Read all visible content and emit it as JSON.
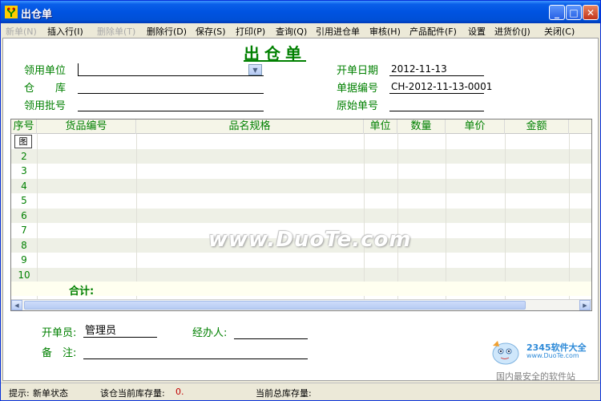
{
  "window": {
    "title": "出仓单"
  },
  "menu": [
    {
      "label": "新单(N)",
      "enabled": false
    },
    {
      "label": "插入行(I)",
      "enabled": true
    },
    {
      "label": "删除单(T)",
      "enabled": false
    },
    {
      "label": "删除行(D)",
      "enabled": true
    },
    {
      "label": "保存(S)",
      "enabled": true
    },
    {
      "label": "打印(P)",
      "enabled": true
    },
    {
      "label": "查询(Q)",
      "enabled": true
    },
    {
      "label": "引用进仓单",
      "enabled": true
    },
    {
      "label": "审核(H)",
      "enabled": true
    },
    {
      "label": "产品配件(F)",
      "enabled": true
    },
    {
      "label": "设置",
      "enabled": true
    },
    {
      "label": "进货价(J)",
      "enabled": true
    },
    {
      "label": "关闭(C)",
      "enabled": true
    }
  ],
  "form": {
    "title": "出仓单",
    "dept_label": "领用单位",
    "dept_value": "",
    "warehouse_label": "仓　　库",
    "warehouse_value": "",
    "batch_label": "领用批号",
    "batch_value": "",
    "date_label": "开单日期",
    "date_value": "2012-11-13",
    "docno_label": "单据编号",
    "docno_value": "CH-2012-11-13-0001",
    "origno_label": "原始单号",
    "origno_value": ""
  },
  "grid": {
    "columns": [
      "序号",
      "货品编号",
      "品名规格",
      "单位",
      "数量",
      "单价",
      "金额"
    ],
    "rows": [
      {
        "num": "图"
      },
      {
        "num": "2"
      },
      {
        "num": "3"
      },
      {
        "num": "4"
      },
      {
        "num": "5"
      },
      {
        "num": "6"
      },
      {
        "num": "7"
      },
      {
        "num": "8"
      },
      {
        "num": "9"
      },
      {
        "num": "10"
      }
    ],
    "total_label": "合计:"
  },
  "footer": {
    "creator_label": "开单员:",
    "creator_value": "管理员",
    "handler_label": "经办人:",
    "handler_value": "",
    "notes_label": "备　注:",
    "notes_value": ""
  },
  "status": {
    "hint_label": "提示:",
    "hint_value": "新单状态",
    "stock_label": "该仓当前库存量:",
    "stock_value": "0.",
    "total_stock_label": "当前总库存量:",
    "total_stock_value": ""
  },
  "watermark": "www.DuoTe.com",
  "brand": {
    "logo": "2345软件大全",
    "site": "www.DuoTe.com",
    "slogan": "国内最安全的软件站"
  }
}
